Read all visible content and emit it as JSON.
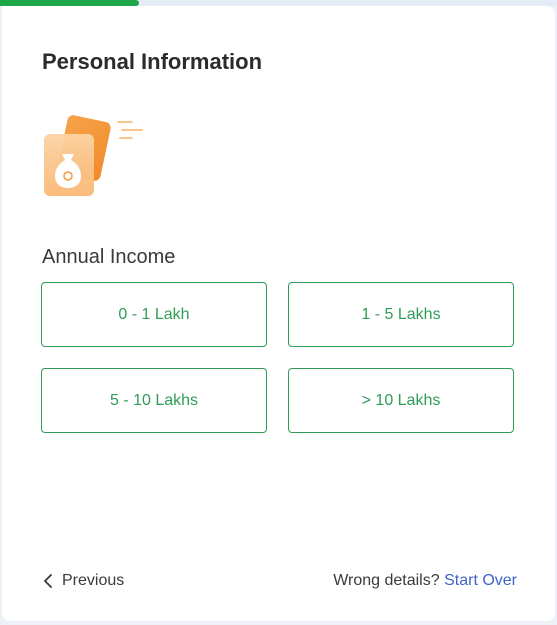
{
  "progress": {
    "fraction": 0.25,
    "color": "#1fa64a"
  },
  "header": {
    "title": "Personal Information"
  },
  "illustration": {
    "icon": "money-bag-icon",
    "colors": [
      "#f59a3a",
      "#fbc68a"
    ]
  },
  "question": {
    "label": "Annual Income"
  },
  "options": [
    {
      "label": "0 - 1 Lakh"
    },
    {
      "label": "1 - 5 Lakhs"
    },
    {
      "label": "5 - 10 Lakhs"
    },
    {
      "label": "> 10 Lakhs"
    }
  ],
  "footer": {
    "previous_label": "Previous",
    "wrong_details_text": "Wrong details?",
    "start_over_label": "Start Over"
  },
  "colors": {
    "accent_green": "#2f9d57",
    "link_blue": "#3f63c8"
  }
}
